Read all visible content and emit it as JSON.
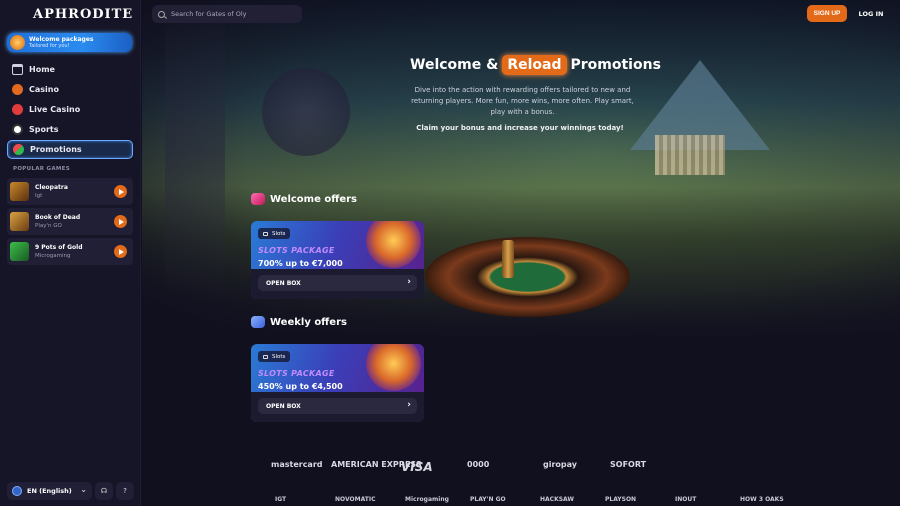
{
  "brand": {
    "logo_text": "APHRODITE",
    "accent": "#e36a18"
  },
  "search": {
    "placeholder": "Search for Gates of Oly"
  },
  "header": {
    "signup_label": "SIGN UP",
    "login_label": "LOG IN"
  },
  "sidebar": {
    "welcome_banner": {
      "title": "Welcome packages",
      "subtitle": "Tailored for you!"
    },
    "nav": [
      {
        "label": "Home",
        "icon": "home-icon"
      },
      {
        "label": "Casino",
        "icon": "casino-icon"
      },
      {
        "label": "Live Casino",
        "icon": "live-casino-icon"
      },
      {
        "label": "Sports",
        "icon": "soccer-ball-icon"
      },
      {
        "label": "Promotions",
        "icon": "watermelon-icon",
        "active": true
      }
    ],
    "popular_header": "POPULAR GAMES",
    "popular_games": [
      {
        "name": "Cleopatra",
        "provider": "Igt"
      },
      {
        "name": "Book of Dead",
        "provider": "Play'n GO"
      },
      {
        "name": "9 Pots of Gold",
        "provider": "Microgaming"
      }
    ],
    "language": "EN (English)"
  },
  "hero": {
    "title_pre": "Welcome &",
    "title_badge": "Reload",
    "title_post": "Promotions",
    "description": "Dive into the action with rewarding offers tailored to new and returning players. More fun, more wins, more often. Play smart, play with a bonus.",
    "claim": "Claim your bonus and increase your winnings today!"
  },
  "offers": {
    "welcome": {
      "title": "Welcome offers",
      "chip": "Slots",
      "package": "SLOTS PACKAGE",
      "amount": "700% up to €7,000",
      "button": "OPEN BOX"
    },
    "weekly": {
      "title": "Weekly offers",
      "chip": "Slots",
      "package": "SLOTS PACKAGE",
      "amount": "450% up to €4,500",
      "button": "OPEN BOX"
    }
  },
  "payments": [
    "mastercard",
    "AMERICAN EXPRESS",
    "VISA",
    "0000",
    "giropay",
    "SOFORT"
  ],
  "providers": [
    "IGT",
    "NOVOMATIC",
    "Microgaming",
    "PLAY'N GO",
    "HACKSAW",
    "PLAYSON",
    "INOUT",
    "HOW 3 OAKS"
  ]
}
